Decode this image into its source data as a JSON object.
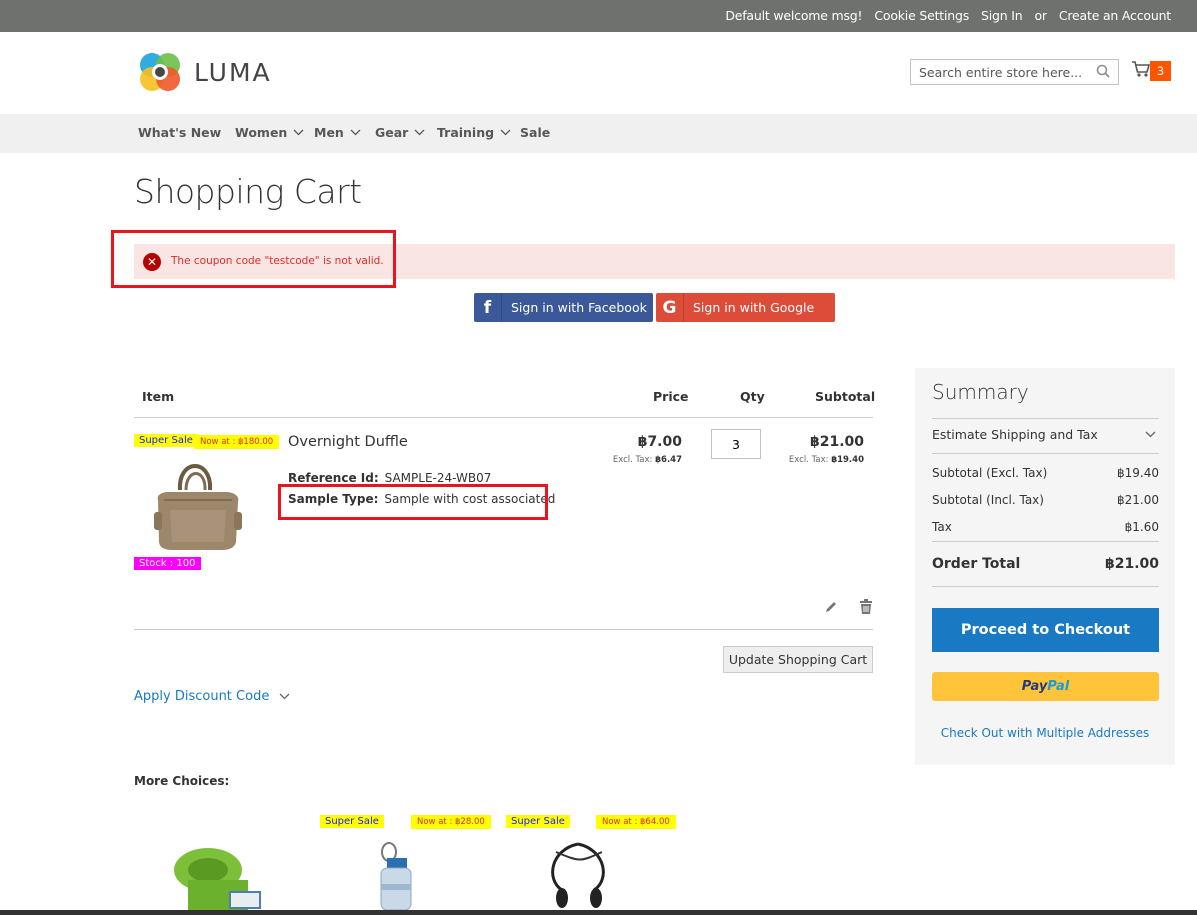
{
  "topbar": {
    "welcome": "Default welcome msg!",
    "cookie": "Cookie Settings",
    "signin": "Sign In",
    "or": "or",
    "create": "Create an Account"
  },
  "header": {
    "logo_text": "LUMA",
    "search_placeholder": "Search entire store here...",
    "cart_count": "3"
  },
  "nav": {
    "items": [
      {
        "label": "What's New",
        "dropdown": false
      },
      {
        "label": "Women",
        "dropdown": true
      },
      {
        "label": "Men",
        "dropdown": true
      },
      {
        "label": "Gear",
        "dropdown": true
      },
      {
        "label": "Training",
        "dropdown": true
      },
      {
        "label": "Sale",
        "dropdown": false
      }
    ]
  },
  "page_title": "Shopping Cart",
  "alert": {
    "message": "The coupon code \"testcode\" is not valid."
  },
  "social": {
    "facebook": "Sign in with Facebook",
    "google": "Sign in with Google"
  },
  "table": {
    "headers": {
      "item": "Item",
      "price": "Price",
      "qty": "Qty",
      "subtotal": "Subtotal"
    }
  },
  "cart_item": {
    "badge_sale": "Super Sale",
    "badge_now": "Now at : ฿180.00",
    "badge_stock": "Stock : 100",
    "name": "Overnight Duffle",
    "ref_label": "Reference Id:",
    "ref_value": "SAMPLE-24-WB07",
    "sample_label": "Sample Type:",
    "sample_value": "Sample with cost associated",
    "price": "฿7.00",
    "price_excl_label": "Excl. Tax:",
    "price_excl": "฿6.47",
    "qty": "3",
    "subtotal": "฿21.00",
    "subtotal_excl_label": "Excl. Tax:",
    "subtotal_excl": "฿19.40"
  },
  "actions": {
    "update": "Update Shopping Cart",
    "discount": "Apply Discount Code"
  },
  "more_choices": {
    "title": "More Choices:",
    "badges": [
      {
        "sale": "Super Sale",
        "now": "Now at : ฿28.00"
      },
      {
        "sale": "Super Sale",
        "now": "Now at : ฿64.00"
      }
    ]
  },
  "summary": {
    "title": "Summary",
    "estimate": "Estimate Shipping and Tax",
    "rows": [
      {
        "label": "Subtotal (Excl. Tax)",
        "value": "฿19.40"
      },
      {
        "label": "Subtotal (Incl. Tax)",
        "value": "฿21.00"
      },
      {
        "label": "Tax",
        "value": "฿1.60"
      }
    ],
    "total_label": "Order Total",
    "total_value": "฿21.00",
    "checkout": "Proceed to Checkout",
    "paypal_a": "Pay",
    "paypal_b": "Pal",
    "multiple": "Check Out with Multiple Addresses"
  },
  "colors": {
    "accent_blue": "#1979c3",
    "alert_red": "#e02b27",
    "cart_badge": "#ff5501",
    "highlight_box": "#e8141f"
  }
}
